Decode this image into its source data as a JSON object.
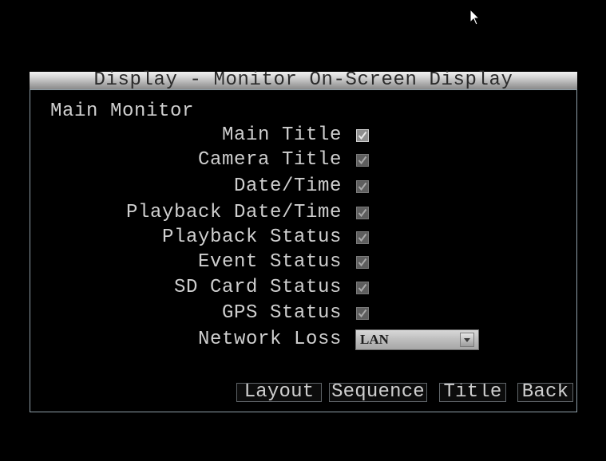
{
  "window": {
    "title": "Display - Monitor On-Screen Display"
  },
  "section": {
    "label": "Main Monitor"
  },
  "options": [
    {
      "label": "Main Title",
      "checked": true,
      "focused": true
    },
    {
      "label": "Camera Title",
      "checked": true,
      "focused": false
    },
    {
      "label": "Date/Time",
      "checked": true,
      "focused": false
    },
    {
      "label": "Playback Date/Time",
      "checked": true,
      "focused": false
    },
    {
      "label": "Playback Status",
      "checked": true,
      "focused": false
    },
    {
      "label": "Event Status",
      "checked": true,
      "focused": false
    },
    {
      "label": "SD Card Status",
      "checked": true,
      "focused": false
    },
    {
      "label": "GPS Status",
      "checked": true,
      "focused": false
    }
  ],
  "network_loss": {
    "label": "Network Loss",
    "value": "LAN",
    "arrow_icon": "chevron-down-icon"
  },
  "buttons": {
    "layout": "Layout",
    "sequence": "Sequence",
    "title": "Title",
    "back": "Back"
  },
  "colors": {
    "background": "#000000",
    "text": "#cfcfcf",
    "frame_border": "#8e9ea8",
    "titlebar_text": "#2b2b2b"
  }
}
